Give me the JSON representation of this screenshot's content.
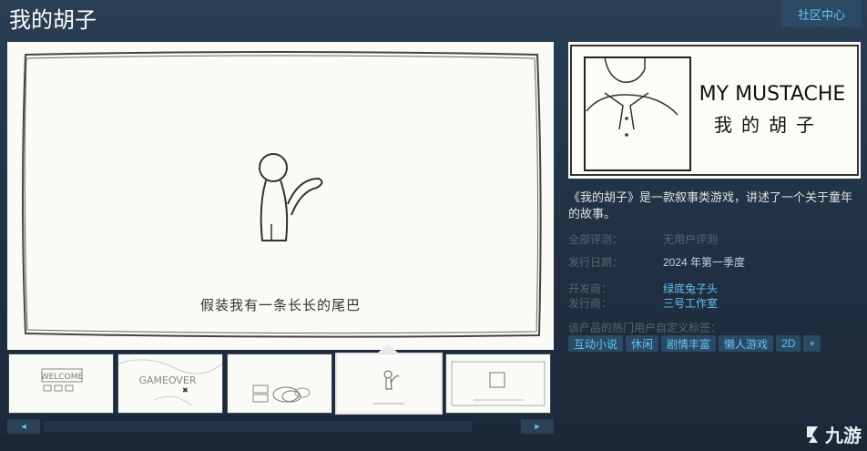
{
  "header": {
    "title": "我的胡子",
    "community_button": "社区中心"
  },
  "main_screenshot": {
    "caption": "假装我有一条长长的尾巴"
  },
  "thumbnails": [
    {
      "text": "WELCOME"
    },
    {
      "text": "GAMEOVER"
    },
    {
      "text": ""
    },
    {
      "text": ""
    },
    {
      "text": ""
    }
  ],
  "scrollbar": {
    "left_arrow": "◄",
    "right_arrow": "►"
  },
  "capsule": {
    "title_en": "MY MUSTACHE",
    "title_cn": "我的胡子"
  },
  "description": "《我的胡子》是一款叙事类游戏，讲述了一个关于童年的故事。",
  "reviews": {
    "label": "全部评测：",
    "value": "无用户评测"
  },
  "release": {
    "label": "发行日期：",
    "value": "2024 年第一季度"
  },
  "developer": {
    "label": "开发商：",
    "value": "绿底兔子头"
  },
  "publisher": {
    "label": "发行商：",
    "value": "三号工作室"
  },
  "tags": {
    "label": "该产品的热门用户自定义标签：",
    "items": [
      "互动小说",
      "休闲",
      "剧情丰富",
      "懒人游戏",
      "2D",
      "+"
    ]
  },
  "watermark": {
    "text": "九游"
  }
}
